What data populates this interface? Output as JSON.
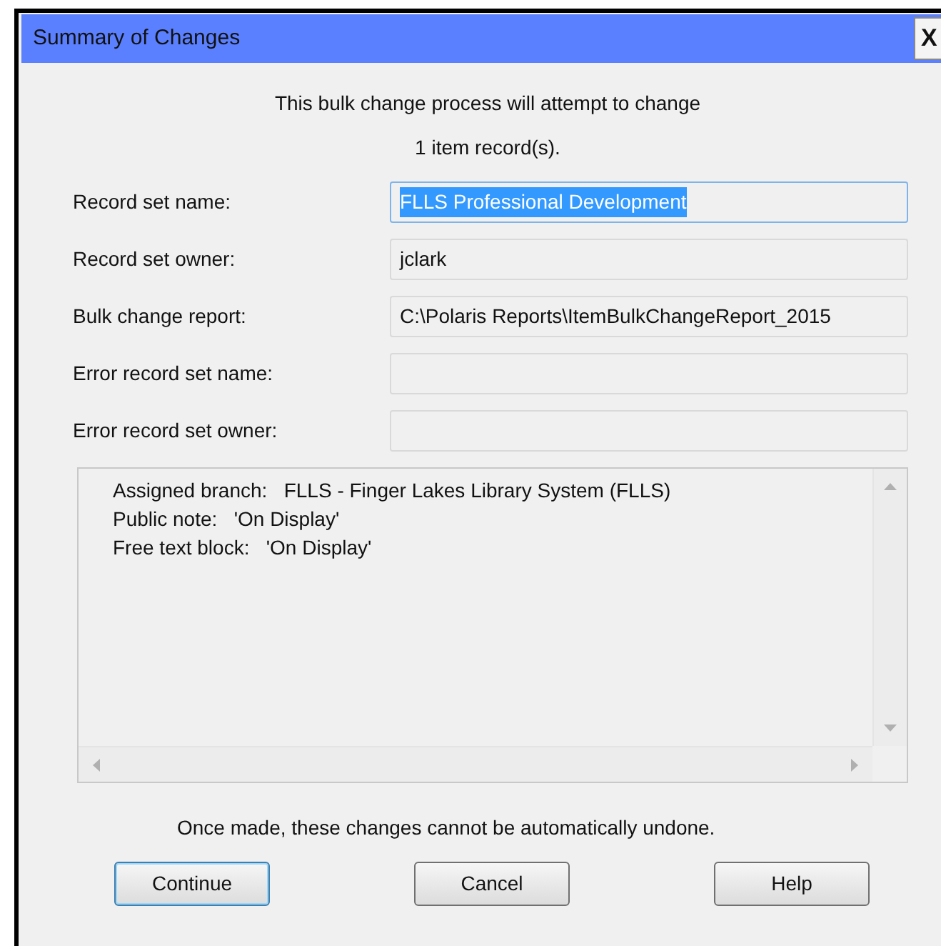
{
  "window": {
    "title": "Summary of Changes",
    "close": "X"
  },
  "intro": [
    "This bulk change process will attempt to change",
    "1  item record(s)."
  ],
  "fields": [
    {
      "label": "Record set name:",
      "value": "FLLS Professional Development",
      "focused": true,
      "text_selected": true
    },
    {
      "label": "Record set owner:",
      "value": "jclark",
      "focused": false,
      "text_selected": false
    },
    {
      "label": "Bulk change report:",
      "value": "C:\\Polaris Reports\\ItemBulkChangeReport_2015",
      "focused": false,
      "text_selected": false
    },
    {
      "label": "Error record set name:",
      "focused": false
    },
    {
      "label": "Error record set owner:",
      "focused": false
    }
  ],
  "summary_lines": [
    {
      "label": "Assigned branch:",
      "value": "FLLS - Finger Lakes Library System (FLLS)"
    },
    {
      "label": "Public note:",
      "value": "'On Display'"
    },
    {
      "label": "Free text block:",
      "value": "'On Display'"
    }
  ],
  "warning": "Once made, these changes cannot be automatically undone.",
  "buttons": [
    {
      "label": "Continue",
      "default": true
    },
    {
      "label": "Cancel",
      "default": false
    },
    {
      "label": "Help",
      "default": false
    }
  ]
}
